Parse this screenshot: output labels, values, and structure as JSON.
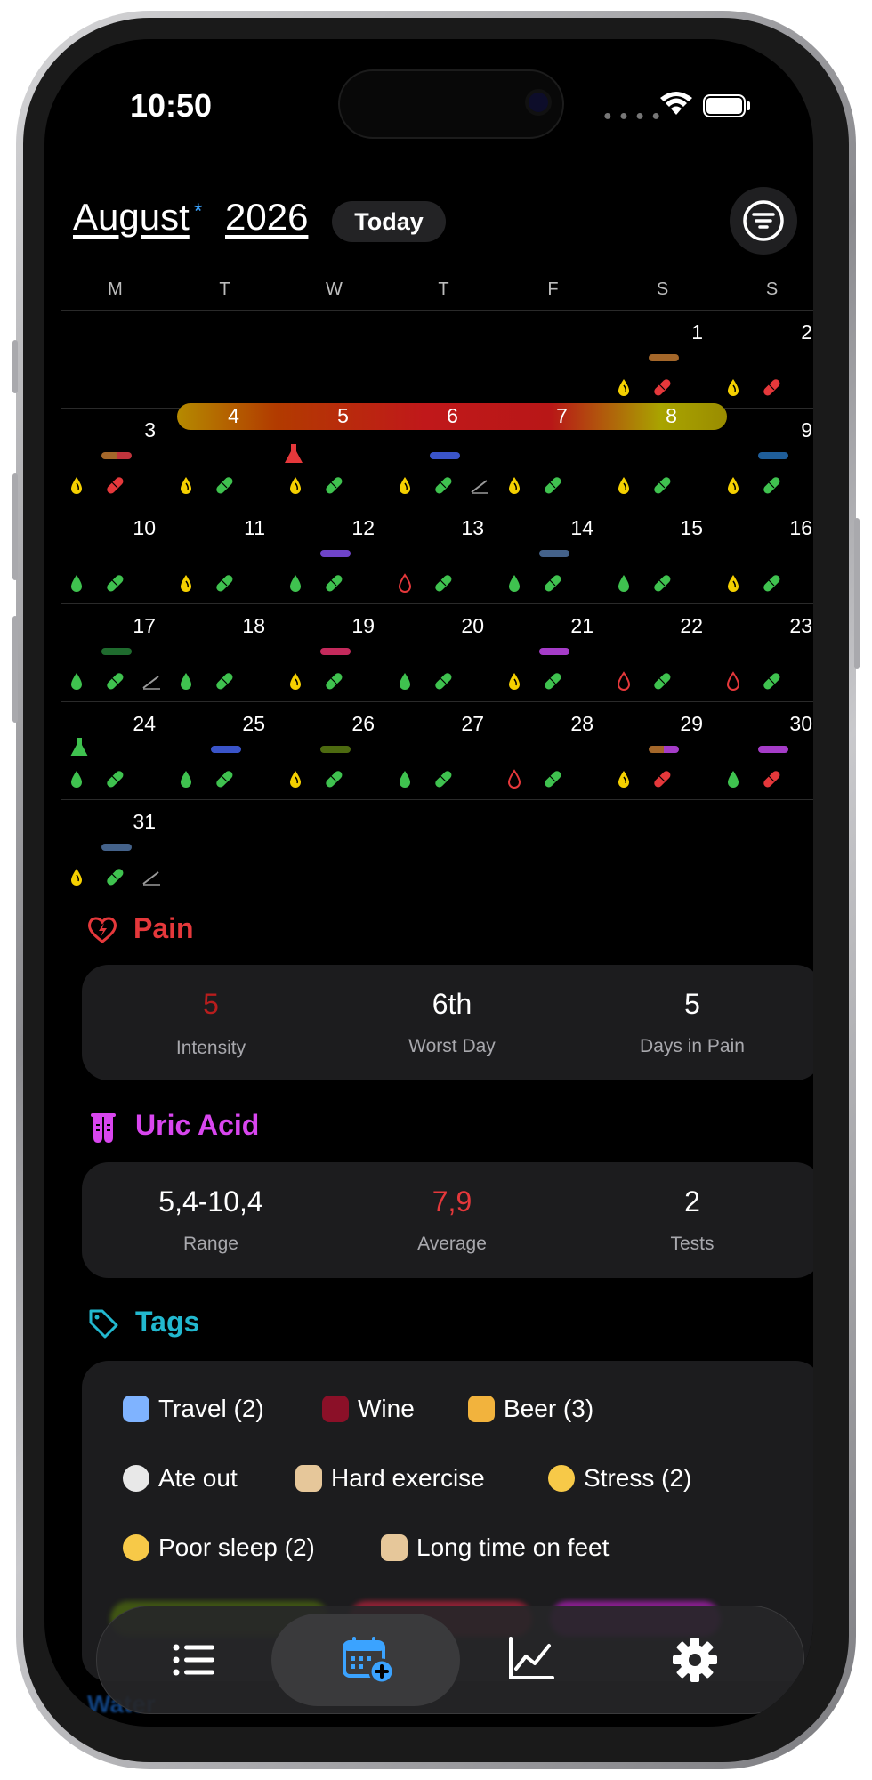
{
  "status_bar": {
    "time": "10:50"
  },
  "header": {
    "month": "August",
    "month_marker": "*",
    "year": "2026",
    "today_label": "Today"
  },
  "weekdays": [
    "M",
    "T",
    "W",
    "T",
    "F",
    "S",
    "S"
  ],
  "calendar": {
    "days": [
      "1",
      "2",
      "3",
      "4",
      "5",
      "6",
      "7",
      "8",
      "9",
      "10",
      "11",
      "12",
      "13",
      "14",
      "15",
      "16",
      "17",
      "18",
      "19",
      "20",
      "21",
      "22",
      "23",
      "24",
      "25",
      "26",
      "27",
      "28",
      "29",
      "30",
      "31"
    ],
    "pain_episode": {
      "from": "4",
      "to": "8"
    }
  },
  "pain": {
    "title": "Pain",
    "intensity_value": "5",
    "intensity_label": "Intensity",
    "worst_value": "6th",
    "worst_label": "Worst Day",
    "days_value": "5",
    "days_label": "Days in Pain"
  },
  "uric_acid": {
    "title": "Uric Acid",
    "range_value": "5,4-10,4",
    "range_label": "Range",
    "avg_value": "7,9",
    "avg_label": "Average",
    "tests_value": "2",
    "tests_label": "Tests"
  },
  "tags": {
    "title": "Tags",
    "items": [
      {
        "label": "Travel (2)",
        "color": "#a53cc8"
      },
      {
        "label": "Wine",
        "color": "#c42a5c"
      },
      {
        "label": "Beer (3)",
        "color": "#8a5a22"
      },
      {
        "label": "Ate out",
        "color": "#6f44c9"
      },
      {
        "label": "Hard exercise",
        "color": "#1f6b2e"
      },
      {
        "label": "Stress (2)",
        "color": "#44628a"
      },
      {
        "label": "Poor sleep (2)",
        "color": "#3a54c9"
      },
      {
        "label": "Long time on feet",
        "color": "#1f5e9a"
      }
    ]
  },
  "water": {
    "title": "Water"
  },
  "tabbar": {
    "items": [
      "list-icon",
      "calendar-add-icon",
      "chart-icon",
      "gear-icon"
    ],
    "selected": "calendar-add-icon"
  },
  "colors": {
    "pain": "#e5383b",
    "uric": "#d946ef",
    "tags": "#22b8cf",
    "accent": "#3ba3ff"
  }
}
